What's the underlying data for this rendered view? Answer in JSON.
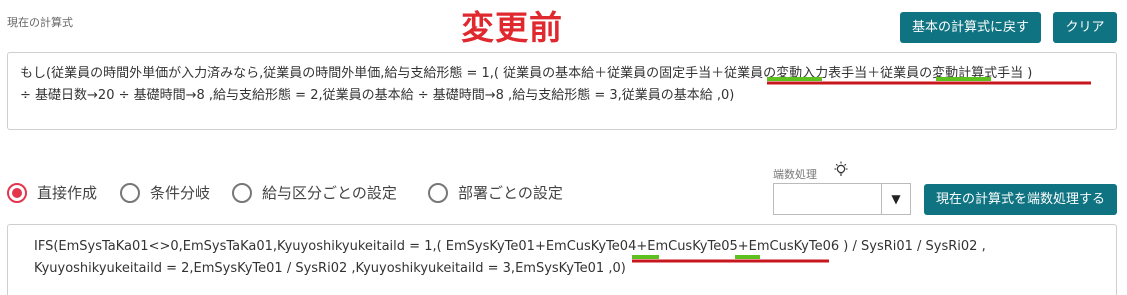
{
  "header": {
    "section_label": "現在の計算式",
    "banner": "変更前",
    "reset_button": "基本の計算式に戻す",
    "clear_button": "クリア"
  },
  "formula_display": {
    "line1": "もし(従業員の時間外単価が入力済みなら,従業員の時間外単価,給与支給形態 = 1,( 従業員の基本給＋従業員の固定手当＋従業員の変動入力表手当＋従業員の変動計算式手当 )",
    "line2": "÷ 基礎日数→20 ÷ 基礎時間→8 ,給与支給形態 = 2,従業員の基本給 ÷ 基礎時間→8 ,給与支給形態 = 3,従業員の基本給 ,0)"
  },
  "radio_options": [
    {
      "label": "直接作成",
      "checked": true
    },
    {
      "label": "条件分岐",
      "checked": false
    },
    {
      "label": "給与区分ごとの設定",
      "checked": false
    },
    {
      "label": "部署ごとの設定",
      "checked": false
    }
  ],
  "rounding": {
    "label": "端数処理",
    "icon": "lightbulb-icon",
    "selected_value": "",
    "apply_button": "現在の計算式を端数処理する"
  },
  "formula_code": {
    "line1": "IFS(EmSysTaKa01<>0,EmSysTaKa01,Kyuyoshikyukeitaild = 1,( EmSysKyTe01+EmCusKyTe04+EmCusKyTe05+EmCusKyTe06 ) / SysRi01 / SysRi02 ,",
    "line2": "Kyuyoshikyukeitaild = 2,EmSysKyTe01 / SysRi02 ,Kyuyoshikyukeitaild = 3,EmSysKyTe01 ,0)"
  },
  "colors": {
    "accent_button": "#0f7382",
    "banner_text": "#e0292f",
    "radio_checked": "#e3364d",
    "annotation_red_line": "#c8161d",
    "annotation_green_line": "#5cc11f"
  }
}
